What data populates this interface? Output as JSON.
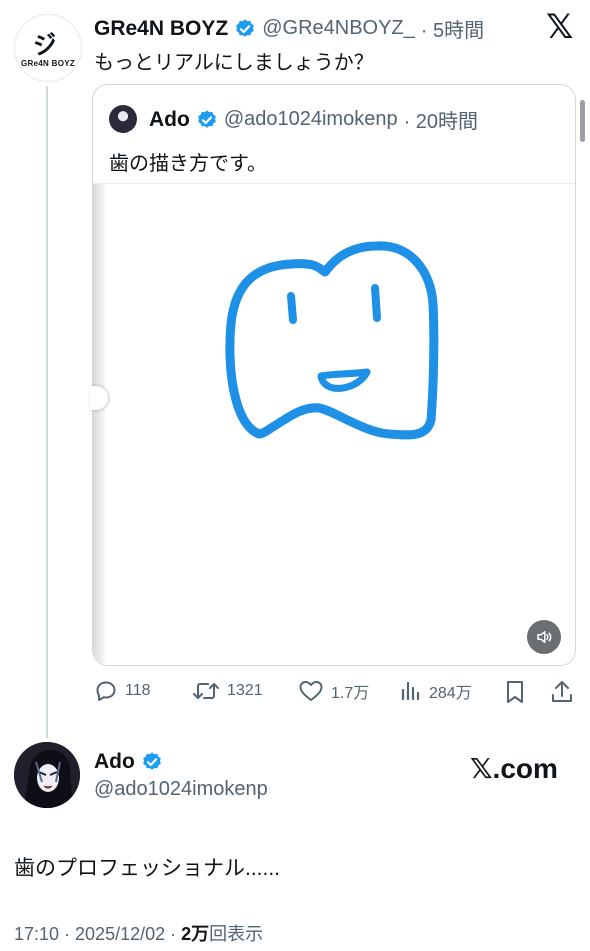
{
  "outer_tweet": {
    "author_name": "GRe4N BOYZ",
    "author_handle": "@GRe4NBOYZ_",
    "time": "· 5時間",
    "text": "もっとリアルにしましょうか？",
    "avatar_logo_text": "GRe4N BOYZ",
    "avatar_mark": "ジ"
  },
  "quoted_tweet": {
    "author_name": "Ado",
    "author_handle": "@ado1024imokenp",
    "time": "· 20時間",
    "text": "歯の描き方です。"
  },
  "actions": {
    "replies": "118",
    "retweets": "1321",
    "likes": "1.7万",
    "views": "284万"
  },
  "footer_tweet": {
    "author_name": "Ado",
    "author_handle": "@ado1024imokenp",
    "brand": "𝕏.com",
    "text": "歯のプロフェッショナル......",
    "timestamp": "17:10 · 2025/12/02 · ",
    "view_count": "2万",
    "view_label": "回表示"
  },
  "header": {
    "x_logo": "𝕏"
  },
  "colors": {
    "verified": "#1d9bf0",
    "drawing": "#1e90e6",
    "text_secondary": "#536471"
  },
  "icons": [
    "verified-icon",
    "x-logo-icon",
    "reply-icon",
    "retweet-icon",
    "like-icon",
    "views-icon",
    "bookmark-icon",
    "share-icon",
    "speaker-icon"
  ]
}
